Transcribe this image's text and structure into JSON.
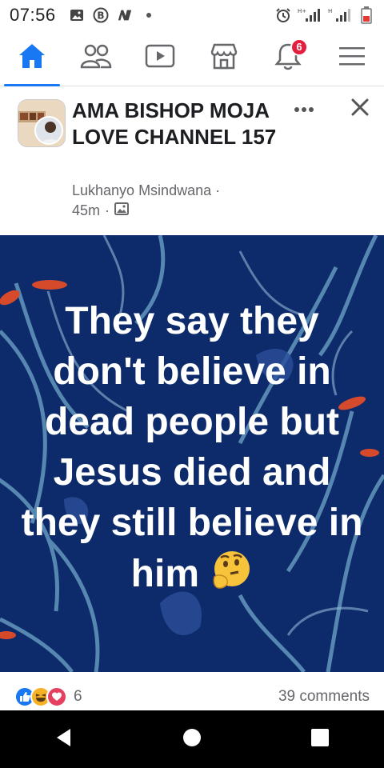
{
  "status_bar": {
    "time": "07:56",
    "net_label_1": "H+",
    "net_label_2": "H"
  },
  "nav": {
    "items": [
      {
        "name": "home",
        "icon": "home-icon",
        "active": true
      },
      {
        "name": "friends",
        "icon": "friends-icon"
      },
      {
        "name": "watch",
        "icon": "video-icon"
      },
      {
        "name": "marketplace",
        "icon": "marketplace-icon"
      },
      {
        "name": "notifications",
        "icon": "bell-icon",
        "badge": "6"
      },
      {
        "name": "menu",
        "icon": "hamburger-menu-icon"
      }
    ],
    "notifications_badge": "6",
    "accent_color": "#1877f2"
  },
  "post": {
    "title": "AMA BISHOP MOJA LOVE CHANNEL 157",
    "author": "Lukhanyo Msindwana",
    "author_separator": "·",
    "time": "45m",
    "time_separator": "·",
    "more_icon": "more-horizontal-icon",
    "close_icon": "close-icon",
    "image_text": "They say they don't believe in dead people but Jesus died and they still believe in him",
    "image_emoji": "thinking-face-emoji",
    "image_bg_color": "#0d2a6b",
    "reaction_count": "6",
    "comments_label": "39 comments",
    "reactions": [
      "like",
      "haha",
      "love"
    ]
  },
  "android_nav": {
    "buttons": [
      "back",
      "home",
      "recents"
    ]
  }
}
